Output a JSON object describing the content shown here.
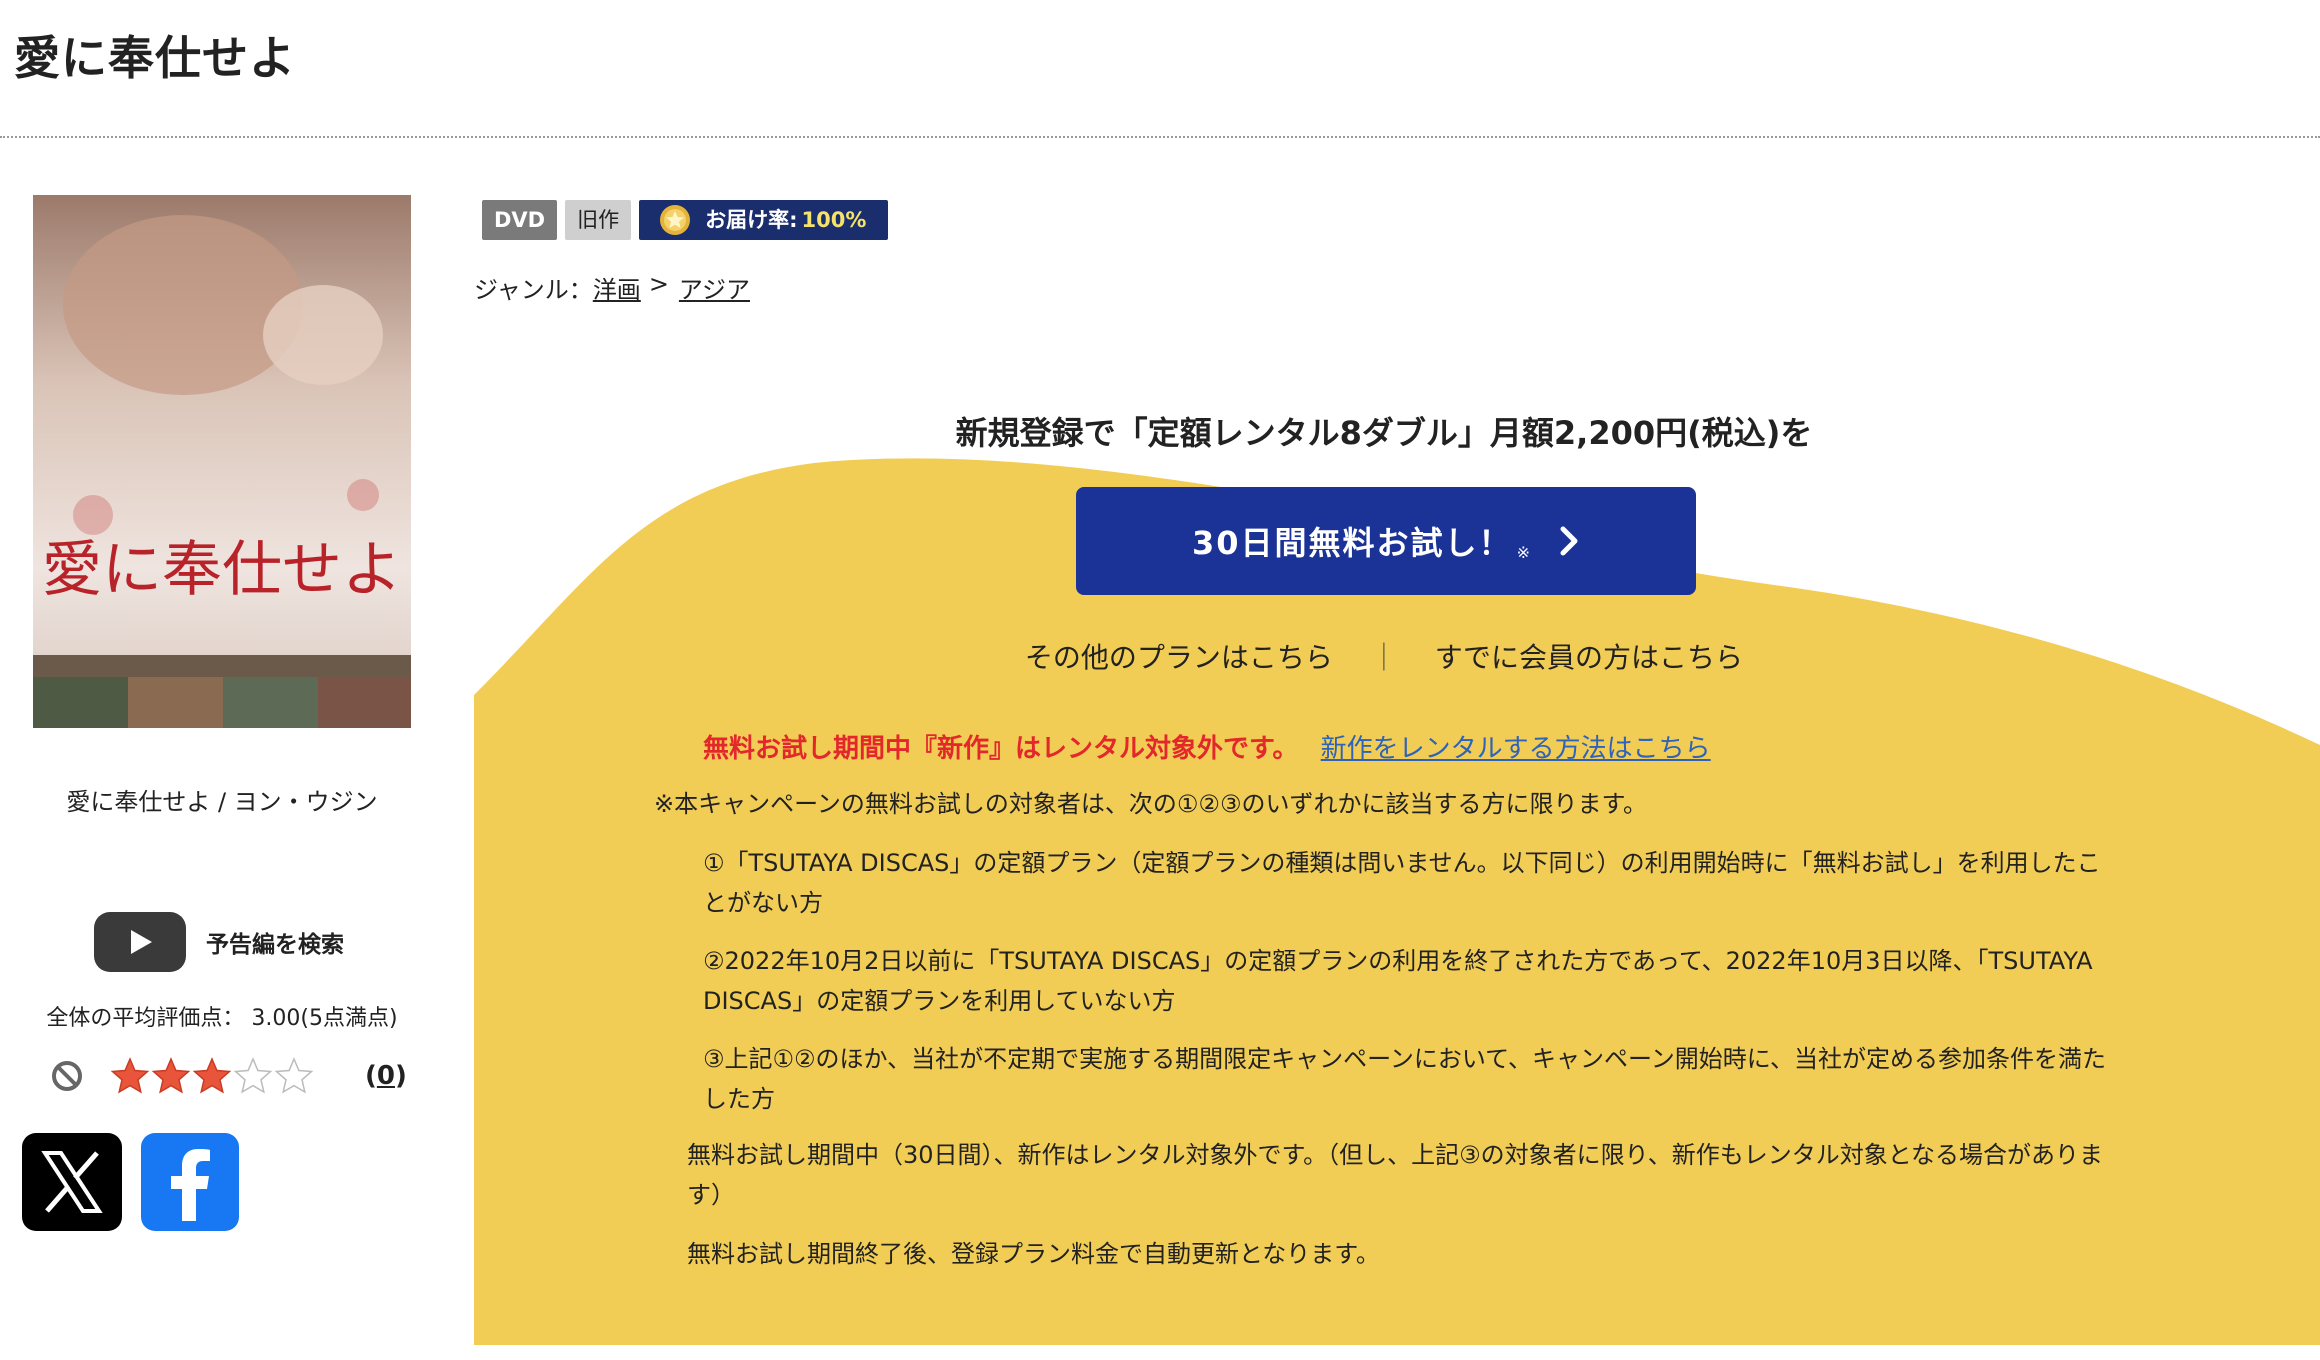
{
  "page": {
    "title": "愛に奉仕せよ"
  },
  "product": {
    "caption": "愛に奉仕せよ / ヨン・ウジン",
    "poster_title": "愛に奉仕せよ",
    "trailer_label": "予告編を検索",
    "rating_text": "全体の平均評価点： 3.00(5点満点)",
    "rating_value": 3,
    "rating_max": 5,
    "review_count": "0"
  },
  "badges": {
    "dvd": "DVD",
    "old": "旧作",
    "delivery_label": "お届け率:",
    "delivery_value": "100%"
  },
  "genre": {
    "label": "ジャンル：",
    "items": [
      "洋画",
      "アジア"
    ],
    "separator": ">"
  },
  "campaign": {
    "headline": "新規登録で「定額レンタル8ダブル」月額2,200円(税込)を",
    "trial_button": "30日間無料お試し！",
    "trial_mark": "※",
    "other_plans": "その他のプランはこちら",
    "links_separator": "｜",
    "member_link": "すでに会員の方はこちら",
    "notice_red": "無料お試し期間中『新作』はレンタル対象外です。",
    "notice_link": "新作をレンタルする方法はこちら",
    "note_intro": "※本キャンペーンの無料お試しの対象者は、次の①②③のいずれかに該当する方に限ります。",
    "conditions": [
      "①「TSUTAYA DISCAS」の定額プラン（定額プランの種類は問いません。以下同じ）の利用開始時に「無料お試し」を利用したことがない方",
      "②2022年10月2日以前に「TSUTAYA DISCAS」の定額プランの利用を終了された方であって、2022年10月3日以降、「TSUTAYA DISCAS」の定額プランを利用していない方",
      "③上記①②のほか、当社が不定期で実施する期間限定キャンペーンにおいて、キャンペーン開始時に、当社が定める参加条件を満たした方"
    ],
    "note_period": "無料お試し期間中（30日間）、新作はレンタル対象外です。（但し、上記③の対象者に限り、新作もレンタル対象となる場合があります）",
    "note_renew": "無料お試し期間終了後、登録プラン料金で自動更新となります。"
  },
  "colors": {
    "yellow": "#f2cd55",
    "button_blue": "#1b3296",
    "notice_red": "#e3282c",
    "link_blue": "#2e63b8",
    "badge_navy": "#1a2d6d"
  },
  "icons": {
    "trailer": "youtube-play-icon",
    "no_rating": "prohibited-icon",
    "x": "x-logo-icon",
    "facebook": "facebook-logo-icon",
    "medal": "medal-icon",
    "chevron": "chevron-right-icon"
  }
}
